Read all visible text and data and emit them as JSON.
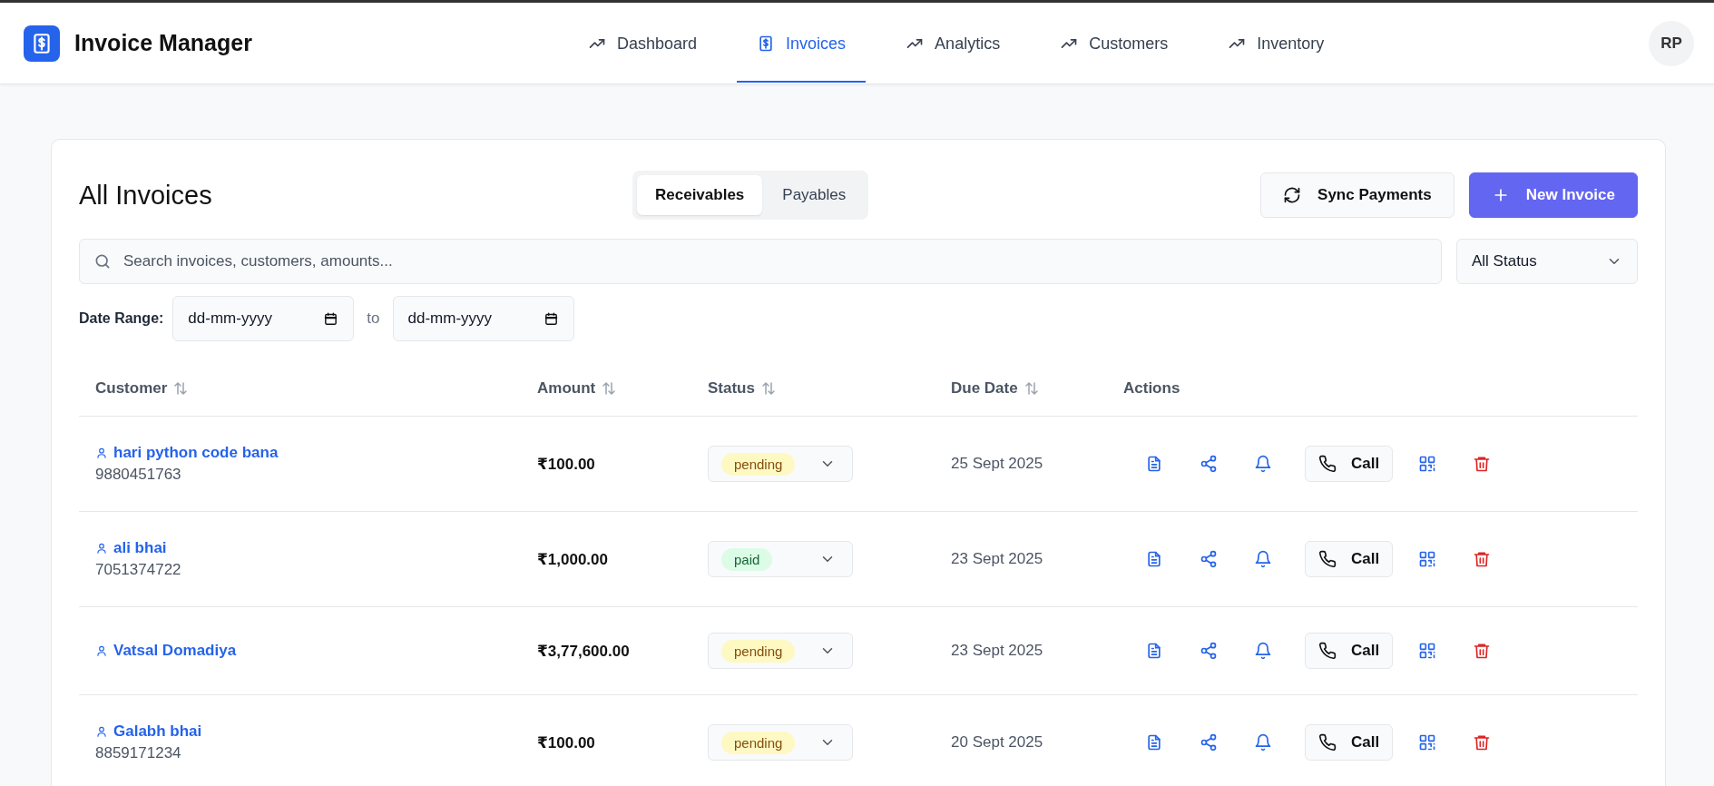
{
  "app": {
    "title": "Invoice Manager",
    "avatar": "RP"
  },
  "nav": [
    {
      "label": "Dashboard",
      "kind": "trend",
      "selected": false
    },
    {
      "label": "Invoices",
      "kind": "invoice",
      "selected": true
    },
    {
      "label": "Analytics",
      "kind": "trend",
      "selected": false
    },
    {
      "label": "Customers",
      "kind": "trend",
      "selected": false
    },
    {
      "label": "Inventory",
      "kind": "trend",
      "selected": false
    }
  ],
  "page": {
    "title": "All Invoices"
  },
  "segments": [
    {
      "label": "Receivables",
      "selected": true
    },
    {
      "label": "Payables",
      "selected": false
    }
  ],
  "buttons": {
    "sync": "Sync Payments",
    "new": "New Invoice"
  },
  "search": {
    "placeholder": "Search invoices, customers, amounts..."
  },
  "status_filter": {
    "value": "All Status"
  },
  "date_range": {
    "label": "Date Range:",
    "from": "dd-mm-yyyy",
    "separator": "to",
    "to": "dd-mm-yyyy"
  },
  "table": {
    "columns": [
      {
        "label": "Customer",
        "sortable": true
      },
      {
        "label": "Amount",
        "sortable": true
      },
      {
        "label": "Status",
        "sortable": true
      },
      {
        "label": "Due Date",
        "sortable": true
      },
      {
        "label": "Actions",
        "sortable": false
      }
    ],
    "rows": [
      {
        "customer": "hari python code bana",
        "phone": "9880451763",
        "amount": "₹100.00",
        "status": "pending",
        "kind": "pending",
        "due": "25 Sept 2025",
        "call": "Call"
      },
      {
        "customer": "ali bhai",
        "phone": "7051374722",
        "amount": "₹1,000.00",
        "status": "paid",
        "kind": "paid",
        "due": "23 Sept 2025",
        "call": "Call"
      },
      {
        "customer": "Vatsal Domadiya",
        "amount": "₹3,77,600.00",
        "status": "pending",
        "kind": "pending",
        "due": "23 Sept 2025",
        "call": "Call"
      },
      {
        "customer": "Galabh bhai",
        "phone": "8859171234",
        "amount": "₹100.00",
        "status": "pending",
        "kind": "pending",
        "due": "20 Sept 2025",
        "call": "Call"
      }
    ]
  }
}
